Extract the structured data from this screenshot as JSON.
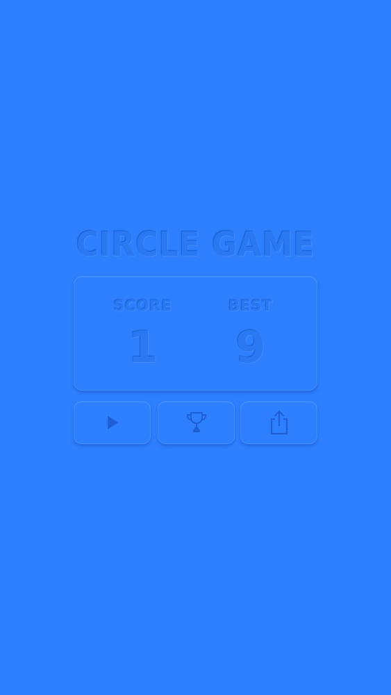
{
  "colors": {
    "background": "#2e7ffd",
    "text": "#2a78f2",
    "panel": "#2e7ffd",
    "icon": "#1f5fd6"
  },
  "title": "CIRCLE GAME",
  "score": {
    "label": "SCORE",
    "value": "1"
  },
  "best": {
    "label": "BEST",
    "value": "9"
  },
  "buttons": {
    "play": {
      "icon": "play-icon"
    },
    "leaderboard": {
      "icon": "trophy-icon"
    },
    "share": {
      "icon": "share-icon"
    }
  }
}
